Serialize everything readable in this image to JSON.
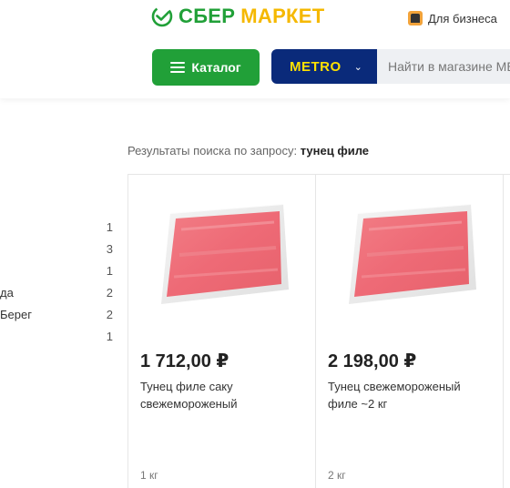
{
  "header": {
    "logo_part1": "СБЕР",
    "logo_part2": "МАРКЕТ",
    "business_link": "Для бизнеса",
    "catalog_button": "Каталог",
    "store_name": "METRO",
    "search_placeholder": "Найти в магазине METRO"
  },
  "search_results": {
    "prefix": "Результаты поиска по запросу:",
    "query": "тунец филе"
  },
  "filters": [
    {
      "label": "",
      "count": "1"
    },
    {
      "label": "",
      "count": "3"
    },
    {
      "label": "",
      "count": "1"
    },
    {
      "label": "да",
      "count": "2"
    },
    {
      "label": "Берег",
      "count": "2"
    },
    {
      "label": "",
      "count": "1"
    }
  ],
  "products": [
    {
      "price": "1 712,00 ₽",
      "name": "Тунец филе саку свежемороженый",
      "weight": "1 кг"
    },
    {
      "price": "2 198,00 ₽",
      "name": "Тунец свежемороженый филе ~2 кг",
      "weight": "2 кг"
    }
  ],
  "colors": {
    "brand_green": "#21a038",
    "brand_yellow": "#f5b800",
    "metro_blue": "#0a2a7a",
    "metro_yellow": "#ffe100"
  }
}
